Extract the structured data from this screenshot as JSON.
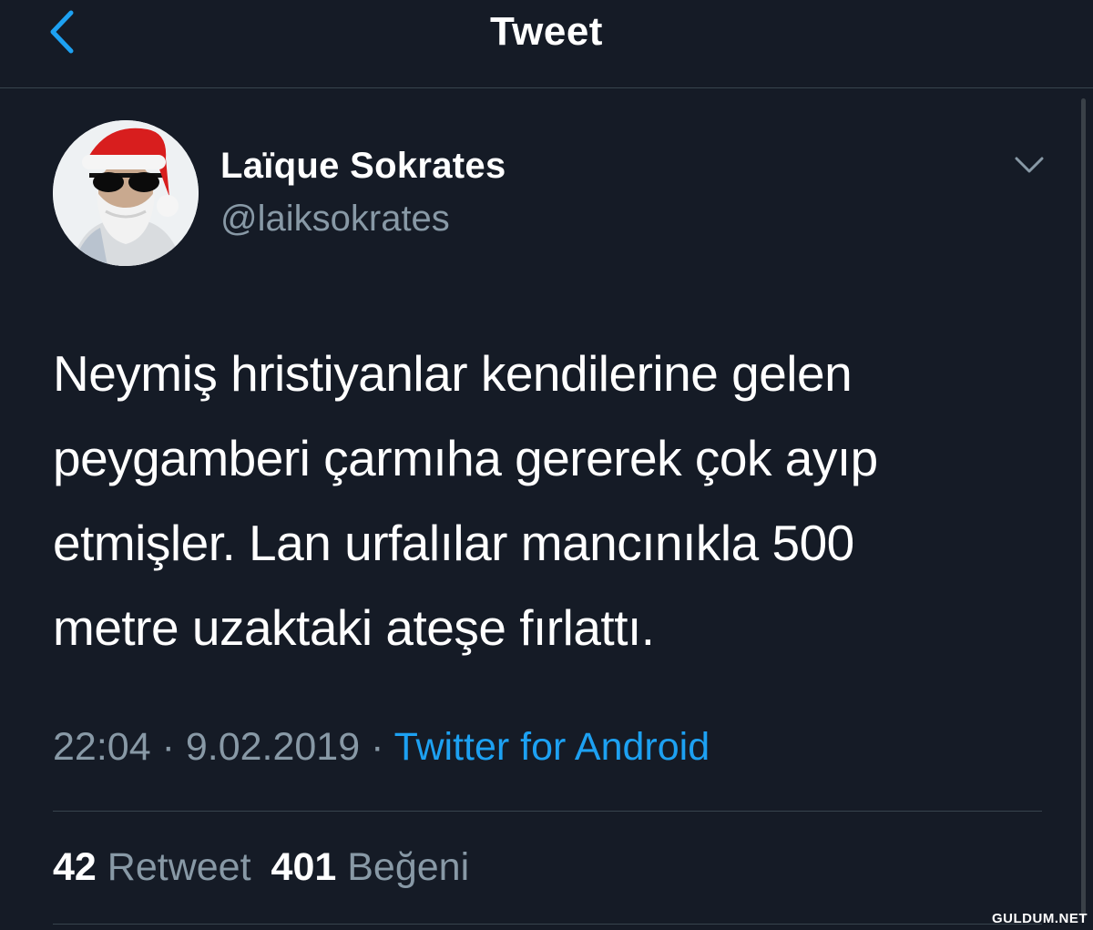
{
  "header": {
    "title": "Tweet",
    "back_icon": "chevron-left-icon"
  },
  "author": {
    "name": "Laïque Sokrates",
    "handle": "@laiksokrates",
    "avatar": "santa-hat-sunglasses-bearded-man"
  },
  "tweet": {
    "lines": [
      "Neymiş hristiyanlar kendilerine gelen",
      "peygamberi çarmıha gererek çok ayıp",
      "etmişler. Lan urfalılar mancınıkla 500",
      "metre uzaktaki ateşe fırlattı."
    ]
  },
  "meta": {
    "time": "22:04",
    "sep1": "·",
    "date": "9.02.2019",
    "sep2": "·",
    "source": "Twitter for Android"
  },
  "stats": {
    "retweet_count": "42",
    "retweet_label": "Retweet",
    "like_count": "401",
    "like_label": "Beğeni"
  },
  "watermark": "GULDUM.NET",
  "colors": {
    "background": "#151b26",
    "accent": "#1da1f2",
    "secondary_text": "#8899a6",
    "divider": "#38444d"
  }
}
